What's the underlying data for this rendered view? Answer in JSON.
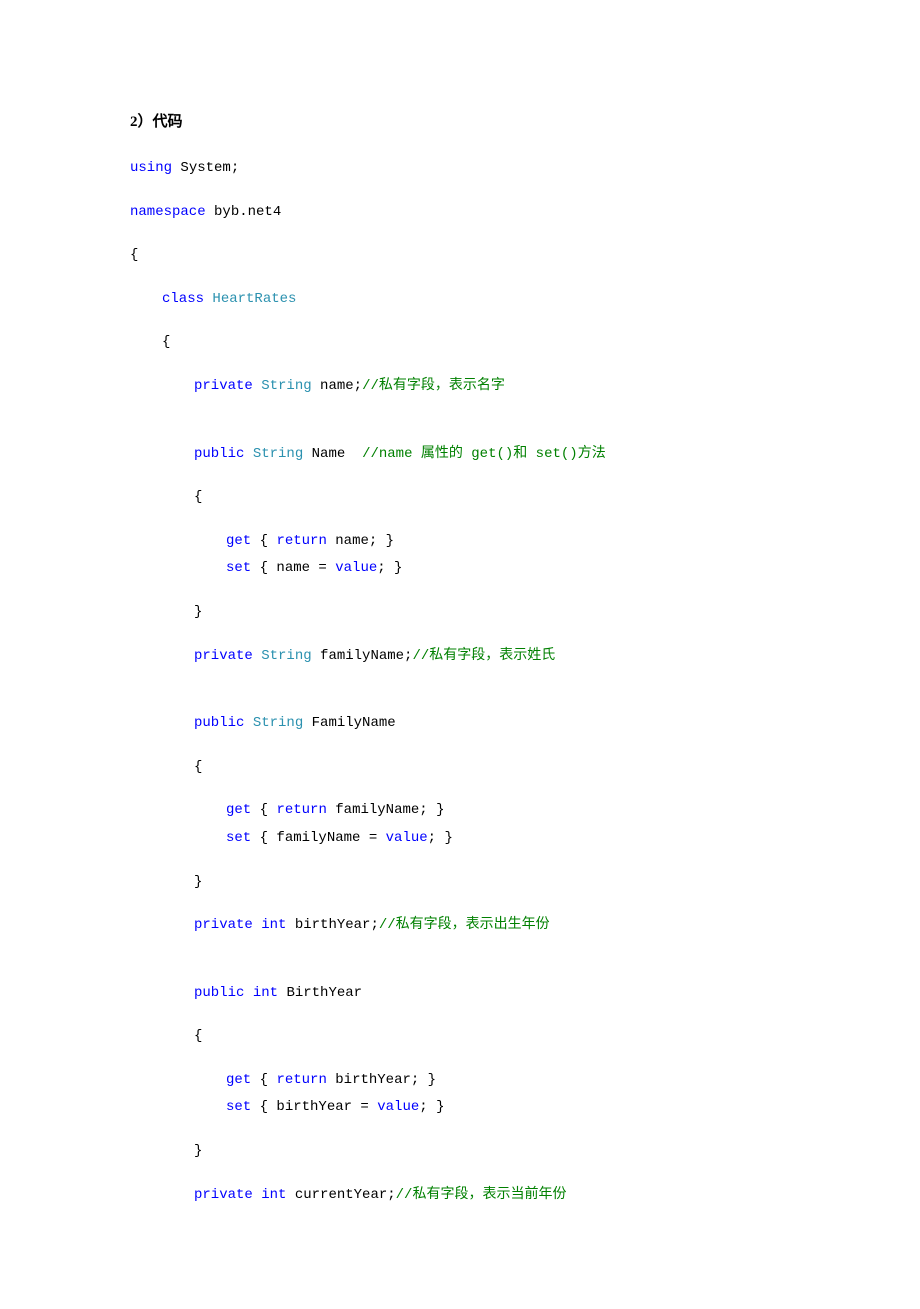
{
  "heading": "2）代码",
  "lines": [
    {
      "indent": "",
      "gap": false,
      "tokens": [
        {
          "cls": "kw-blue",
          "text": "using"
        },
        {
          "cls": "text-black",
          "text": " System;"
        }
      ]
    },
    {
      "indent": "",
      "gap": false,
      "tokens": [
        {
          "cls": "kw-blue",
          "text": "namespace"
        },
        {
          "cls": "text-black",
          "text": " byb.net4"
        }
      ]
    },
    {
      "indent": "",
      "gap": false,
      "tokens": [
        {
          "cls": "text-black",
          "text": "{"
        }
      ]
    },
    {
      "indent": "indent1",
      "gap": false,
      "tokens": [
        {
          "cls": "kw-blue",
          "text": "class"
        },
        {
          "cls": "text-black",
          "text": " "
        },
        {
          "cls": "kw-teal",
          "text": "HeartRates"
        }
      ]
    },
    {
      "indent": "indent1",
      "gap": false,
      "tokens": [
        {
          "cls": "text-black",
          "text": "{"
        }
      ]
    },
    {
      "indent": "indent2",
      "gap": true,
      "tokens": [
        {
          "cls": "kw-blue",
          "text": "private"
        },
        {
          "cls": "text-black",
          "text": " "
        },
        {
          "cls": "kw-teal",
          "text": "String"
        },
        {
          "cls": "text-black",
          "text": " name;"
        },
        {
          "cls": "kw-green",
          "text": "//私有字段，表示名字"
        }
      ]
    },
    {
      "indent": "indent2",
      "gap": false,
      "tokens": [
        {
          "cls": "kw-blue",
          "text": "public"
        },
        {
          "cls": "text-black",
          "text": " "
        },
        {
          "cls": "kw-teal",
          "text": "String"
        },
        {
          "cls": "text-black",
          "text": " Name  "
        },
        {
          "cls": "kw-green",
          "text": "//name 属性的 get()和 set()方法"
        }
      ]
    },
    {
      "indent": "indent2",
      "gap": false,
      "tokens": [
        {
          "cls": "text-black",
          "text": "{"
        }
      ]
    },
    {
      "indent": "indent3",
      "gap": false,
      "tight": true,
      "tokens": [
        {
          "cls": "kw-blue",
          "text": "get"
        },
        {
          "cls": "text-black",
          "text": " { "
        },
        {
          "cls": "kw-blue",
          "text": "return"
        },
        {
          "cls": "text-black",
          "text": " name; }"
        }
      ]
    },
    {
      "indent": "indent3",
      "gap": false,
      "tokens": [
        {
          "cls": "kw-blue",
          "text": "set"
        },
        {
          "cls": "text-black",
          "text": " { name = "
        },
        {
          "cls": "kw-blue",
          "text": "value"
        },
        {
          "cls": "text-black",
          "text": "; }"
        }
      ]
    },
    {
      "indent": "indent2",
      "gap": false,
      "tokens": [
        {
          "cls": "text-black",
          "text": "}"
        }
      ]
    },
    {
      "indent": "indent2",
      "gap": true,
      "tokens": [
        {
          "cls": "kw-blue",
          "text": "private"
        },
        {
          "cls": "text-black",
          "text": " "
        },
        {
          "cls": "kw-teal",
          "text": "String"
        },
        {
          "cls": "text-black",
          "text": " familyName;"
        },
        {
          "cls": "kw-green",
          "text": "//私有字段，表示姓氏"
        }
      ]
    },
    {
      "indent": "indent2",
      "gap": false,
      "tokens": [
        {
          "cls": "kw-blue",
          "text": "public"
        },
        {
          "cls": "text-black",
          "text": " "
        },
        {
          "cls": "kw-teal",
          "text": "String"
        },
        {
          "cls": "text-black",
          "text": " FamilyName"
        }
      ]
    },
    {
      "indent": "indent2",
      "gap": false,
      "tokens": [
        {
          "cls": "text-black",
          "text": "{"
        }
      ]
    },
    {
      "indent": "indent3",
      "gap": false,
      "tight": true,
      "tokens": [
        {
          "cls": "kw-blue",
          "text": "get"
        },
        {
          "cls": "text-black",
          "text": " { "
        },
        {
          "cls": "kw-blue",
          "text": "return"
        },
        {
          "cls": "text-black",
          "text": " familyName; }"
        }
      ]
    },
    {
      "indent": "indent3",
      "gap": false,
      "tokens": [
        {
          "cls": "kw-blue",
          "text": "set"
        },
        {
          "cls": "text-black",
          "text": " { familyName = "
        },
        {
          "cls": "kw-blue",
          "text": "value"
        },
        {
          "cls": "text-black",
          "text": "; }"
        }
      ]
    },
    {
      "indent": "indent2",
      "gap": false,
      "tokens": [
        {
          "cls": "text-black",
          "text": "}"
        }
      ]
    },
    {
      "indent": "indent2",
      "gap": true,
      "tokens": [
        {
          "cls": "kw-blue",
          "text": "private"
        },
        {
          "cls": "text-black",
          "text": " "
        },
        {
          "cls": "kw-blue",
          "text": "int"
        },
        {
          "cls": "text-black",
          "text": " birthYear;"
        },
        {
          "cls": "kw-green",
          "text": "//私有字段，表示出生年份"
        }
      ]
    },
    {
      "indent": "indent2",
      "gap": false,
      "tokens": [
        {
          "cls": "kw-blue",
          "text": "public"
        },
        {
          "cls": "text-black",
          "text": " "
        },
        {
          "cls": "kw-blue",
          "text": "int"
        },
        {
          "cls": "text-black",
          "text": " BirthYear"
        }
      ]
    },
    {
      "indent": "indent2",
      "gap": false,
      "tokens": [
        {
          "cls": "text-black",
          "text": "{"
        }
      ]
    },
    {
      "indent": "indent3",
      "gap": false,
      "tight": true,
      "tokens": [
        {
          "cls": "kw-blue",
          "text": "get"
        },
        {
          "cls": "text-black",
          "text": " { "
        },
        {
          "cls": "kw-blue",
          "text": "return"
        },
        {
          "cls": "text-black",
          "text": " birthYear; }"
        }
      ]
    },
    {
      "indent": "indent3",
      "gap": false,
      "tokens": [
        {
          "cls": "kw-blue",
          "text": "set"
        },
        {
          "cls": "text-black",
          "text": " { birthYear = "
        },
        {
          "cls": "kw-blue",
          "text": "value"
        },
        {
          "cls": "text-black",
          "text": "; }"
        }
      ]
    },
    {
      "indent": "indent2",
      "gap": false,
      "tokens": [
        {
          "cls": "text-black",
          "text": "}"
        }
      ]
    },
    {
      "indent": "indent2",
      "gap": false,
      "tokens": [
        {
          "cls": "kw-blue",
          "text": "private"
        },
        {
          "cls": "text-black",
          "text": " "
        },
        {
          "cls": "kw-blue",
          "text": "int"
        },
        {
          "cls": "text-black",
          "text": " currentYear;"
        },
        {
          "cls": "kw-green",
          "text": "//私有字段，表示当前年份"
        }
      ]
    }
  ]
}
